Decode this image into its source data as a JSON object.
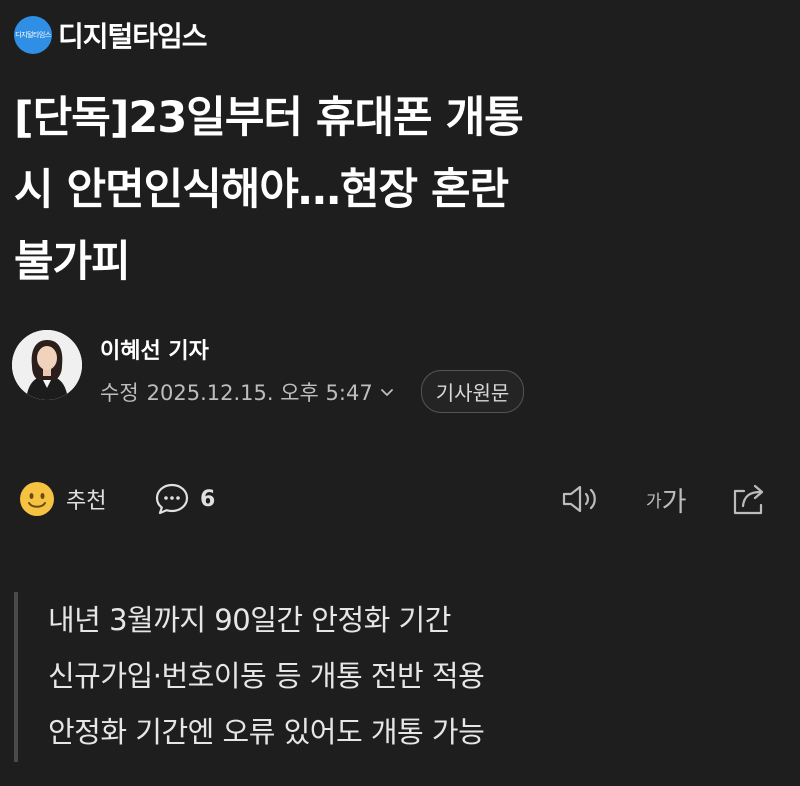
{
  "header": {
    "logo_text": "디지털타임스",
    "brand_name": "디지털타임스",
    "logo_color": "#2f8fe4"
  },
  "article": {
    "headline_lines": [
      "[단독]23일부터 휴대폰 개통",
      "시 안면인식해야…현장 혼란",
      "불가피"
    ],
    "author": "이혜선 기자",
    "modified_label": "수정",
    "datetime": "2025.12.15. 오후 5:47",
    "original_button": "기사원문",
    "summary_lines": [
      "내년 3월까지 90일간 안정화 기간",
      "신규가입·번호이동 등 개통 전반 적용",
      "안정화 기간엔 오류 있어도 개통 가능"
    ]
  },
  "actions": {
    "recommend_label": "추천",
    "recommend_icon": "smiley-icon",
    "comment_icon": "comment-bubble-icon",
    "comment_count": "6",
    "audio_icon": "speaker-icon",
    "font_size_small": "가",
    "font_size_big": "가",
    "share_icon": "share-icon"
  },
  "colors": {
    "background": "#1e1e1e",
    "text": "#ffffff",
    "secondary_text": "#bdbdbd",
    "summary_bar": "#4a4a4a",
    "smiley": "#f5c242"
  }
}
